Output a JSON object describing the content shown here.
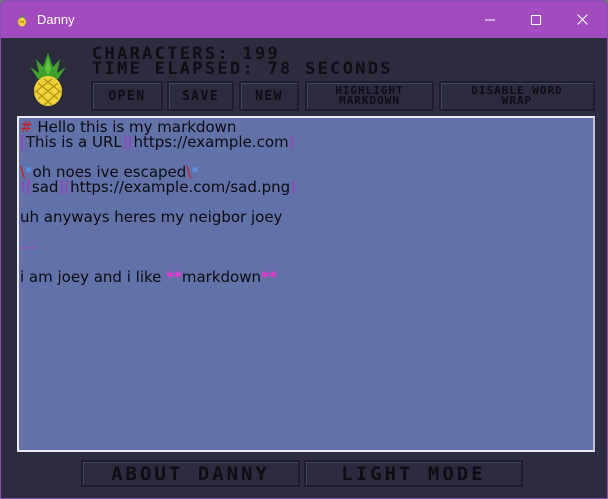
{
  "window": {
    "title": "Danny"
  },
  "stats": {
    "characters": "CHARACTERS: 199",
    "time_elapsed": "TIME ELAPSED: 78 SECONDS"
  },
  "toolbar": {
    "open": "OPEN",
    "save": "SAVE",
    "new": "NEW",
    "highlight_1": "HIGHLIGHT",
    "highlight_2": "MARKDOWN",
    "wrap_1": "DISABLE WORD",
    "wrap_2": "WRAP"
  },
  "editor": {
    "line1_hash": "#",
    "line1_text": " Hello this is my markdown",
    "line2_open": "[",
    "line2_text": "This is a URL",
    "line2_mid": "](",
    "line2_url": "https://example.com",
    "line2_close": ")",
    "line3_bs": "\\",
    "line3_star1": "*",
    "line3_text": "oh noes ive escaped",
    "line3_bs2": "\\",
    "line3_star2": "*",
    "line4_open": "![",
    "line4_text": "sad",
    "line4_mid": "](",
    "line4_url": "https://example.com/sad.png",
    "line4_close": ")",
    "line5": "uh anyways heres my neigbor joey",
    "line6": "---",
    "line7_text": "i am joey and i like ",
    "line7_star1": "**",
    "line7_bold": "markdown",
    "line7_star2": "**"
  },
  "footer": {
    "about": "ABOUT DANNY",
    "light": "LIGHT MODE"
  },
  "colors": {
    "titlebar": "#a24bbe",
    "background": "#2c2c3e",
    "editor": "#6272a8",
    "syntax_purple": "#a23bc4",
    "syntax_red": "#d01a1a",
    "syntax_blue": "#5aa0ff",
    "syntax_magenta": "#ff2bd8"
  },
  "icons": {
    "app": "pineapple-icon",
    "logo": "pineapple-icon",
    "minimize": "minimize-icon",
    "maximize": "maximize-icon",
    "close": "close-icon"
  }
}
